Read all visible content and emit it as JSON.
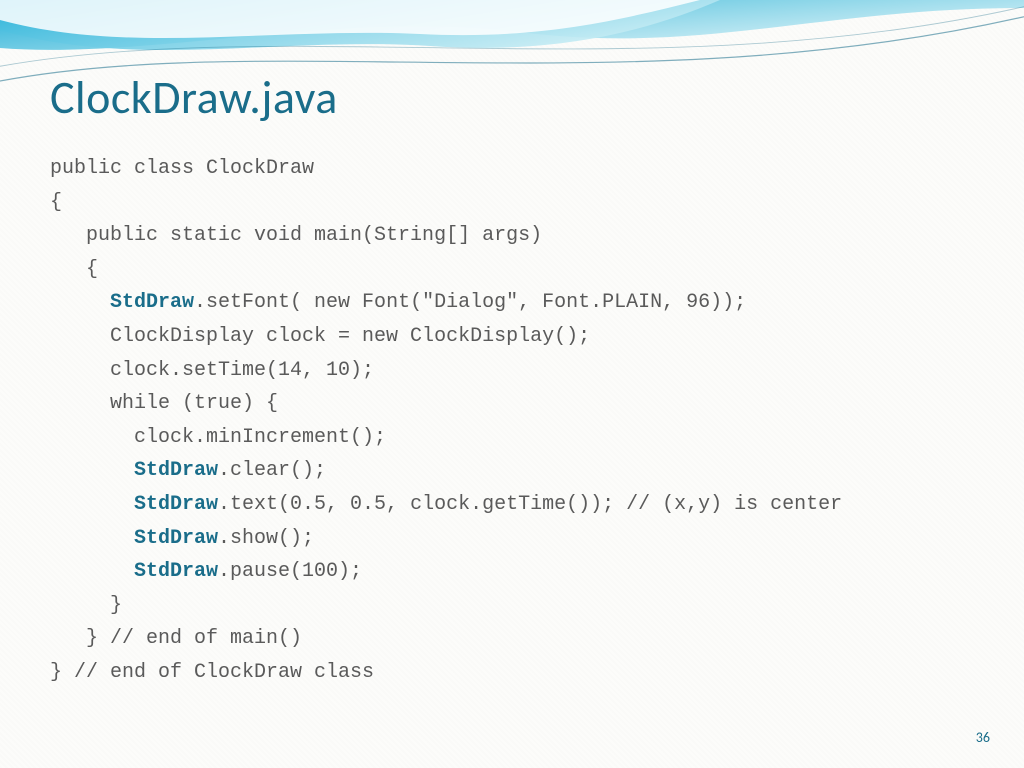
{
  "slide": {
    "title": "ClockDraw.java",
    "page_number": "36",
    "theme": {
      "accent": "#1a6d8a",
      "keyword_color": "#1a6d8a",
      "body_text_color": "#5a5a5a",
      "wave_gradient_start": "#0fa8d6",
      "wave_gradient_end": "#8fd9ea"
    },
    "code": {
      "l01": "public class ClockDraw",
      "l02": "{",
      "l03": "   public static void main(String[] args)",
      "l04": "   {",
      "l05a": "     ",
      "l05kw": "StdDraw",
      "l05b": ".setFont( new Font(\"Dialog\", Font.PLAIN, 96));",
      "l06": "     ClockDisplay clock = new ClockDisplay();",
      "l07": "     clock.setTime(14, 10);",
      "l08": "     while (true) {",
      "l09": "       clock.minIncrement();",
      "l10a": "       ",
      "l10kw": "StdDraw",
      "l10b": ".clear();",
      "l11a": "       ",
      "l11kw": "StdDraw",
      "l11b": ".text(0.5, 0.5, clock.getTime()); // (x,y) is center",
      "l12a": "       ",
      "l12kw": "StdDraw",
      "l12b": ".show();",
      "l13a": "       ",
      "l13kw": "StdDraw",
      "l13b": ".pause(100);",
      "l14": "     }",
      "l15": "   } // end of main()",
      "l16": "} // end of ClockDraw class"
    }
  }
}
